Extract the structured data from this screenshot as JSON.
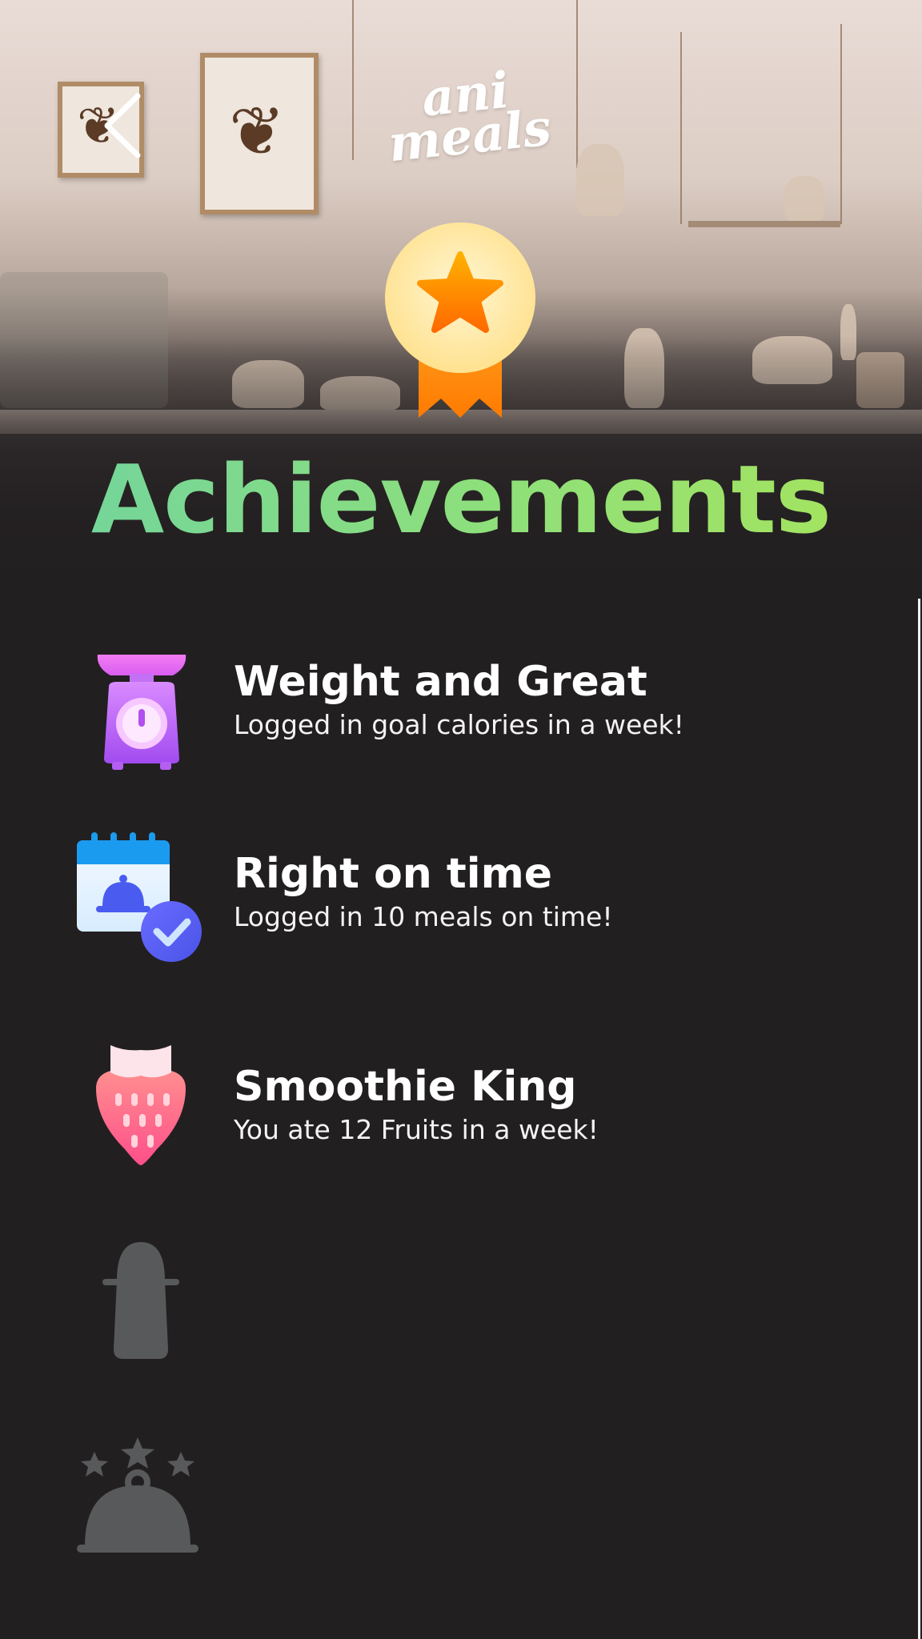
{
  "header": {
    "back_icon": "chevron-left-icon",
    "logo_line1": "ani",
    "logo_line2": "meals",
    "medal_icon": "star-medal-icon"
  },
  "page": {
    "title": "Achievements"
  },
  "achievements": [
    {
      "icon": "kitchen-scale-icon",
      "name": "Weight and Great",
      "description": "Logged in goal calories in a week!",
      "unlocked": true
    },
    {
      "icon": "calendar-cloche-check-icon",
      "name": "Right on time",
      "description": "Logged in 10 meals on time!",
      "unlocked": true
    },
    {
      "icon": "strawberry-icon",
      "name": "Smoothie King",
      "description": "You ate 12 Fruits in a week!",
      "unlocked": true
    },
    {
      "icon": "salt-shaker-icon",
      "unlocked": false
    },
    {
      "icon": "cloche-stars-icon",
      "unlocked": false
    }
  ],
  "colors": {
    "background": "#221f20",
    "title_gradient_start": "#6fd3a0",
    "title_gradient_end": "#a8e45a",
    "locked_icon": "#58595b"
  }
}
